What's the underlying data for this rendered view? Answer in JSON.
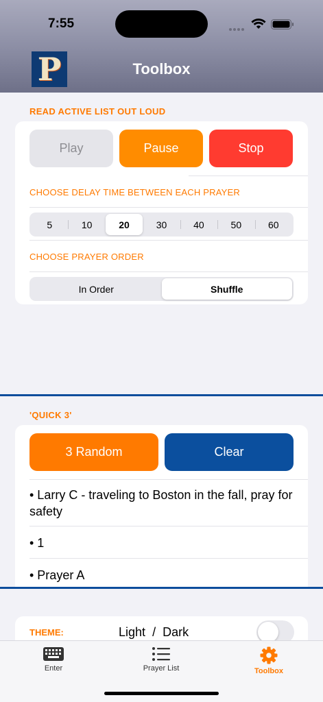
{
  "status": {
    "time": "7:55"
  },
  "header": {
    "logo_letter": "P",
    "title": "Toolbox"
  },
  "read_aloud": {
    "section_label": "READ ACTIVE LIST OUT LOUD",
    "play_label": "Play",
    "pause_label": "Pause",
    "stop_label": "Stop",
    "delay_label": "CHOOSE DELAY TIME BETWEEN EACH PRAYER",
    "delay_options": [
      "5",
      "10",
      "20",
      "30",
      "40",
      "50",
      "60"
    ],
    "delay_selected": "20",
    "order_label": "CHOOSE PRAYER ORDER",
    "order_options": [
      "In Order",
      "Shuffle"
    ],
    "order_selected": "Shuffle"
  },
  "quick3": {
    "section_label": "'QUICK 3'",
    "random_label": "3 Random",
    "clear_label": "Clear",
    "items": [
      "• Larry C - traveling to Boston in the fall, pray for safety",
      "• 1",
      "• Prayer A"
    ]
  },
  "theme": {
    "label": "THEME:",
    "light_label": "Light",
    "slash": "/",
    "dark_label": "Dark",
    "dark_enabled": false
  },
  "tabs": [
    {
      "label": "Enter",
      "icon": "keyboard-icon",
      "active": false
    },
    {
      "label": "Prayer List",
      "icon": "list-icon",
      "active": false
    },
    {
      "label": "Toolbox",
      "icon": "gear-icon",
      "active": true
    }
  ],
  "colors": {
    "accent_orange": "#ff7a00",
    "stop_red": "#ff3b30",
    "clear_blue": "#0b4f9e",
    "divider_blue": "#0d4d9c",
    "play_disabled": "#e5e5ea"
  }
}
